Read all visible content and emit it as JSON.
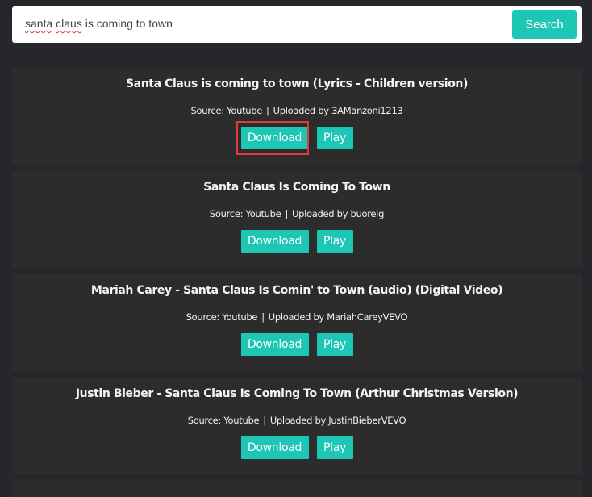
{
  "search": {
    "query": "santa claus is coming to town",
    "query_parts": [
      "santa",
      "claus",
      "is coming to town"
    ],
    "button_label": "Search"
  },
  "results": [
    {
      "title": "Santa Claus is coming to town (Lyrics - Children version)",
      "source_label": "Source: Youtube",
      "uploader_label": "Uploaded by 3AManzoni1213",
      "download_label": "Download",
      "play_label": "Play",
      "highlighted": true
    },
    {
      "title": "Santa Claus Is Coming To Town",
      "source_label": "Source: Youtube",
      "uploader_label": "Uploaded by buoreig",
      "download_label": "Download",
      "play_label": "Play"
    },
    {
      "title": "Mariah Carey - Santa Claus Is Comin' to Town (audio) (Digital Video)",
      "source_label": "Source: Youtube",
      "uploader_label": "Uploaded by MariahCareyVEVO",
      "download_label": "Download",
      "play_label": "Play"
    },
    {
      "title": "Justin Bieber - Santa Claus Is Coming To Town (Arthur Christmas Version)",
      "source_label": "Source: Youtube",
      "uploader_label": "Uploaded by JustinBieberVEVO",
      "download_label": "Download",
      "play_label": "Play"
    }
  ],
  "separator": "|",
  "colors": {
    "accent": "#1dc6b5",
    "page_bg": "#26272a",
    "card_bg": "#2c2c2c",
    "highlight": "#e53935"
  }
}
